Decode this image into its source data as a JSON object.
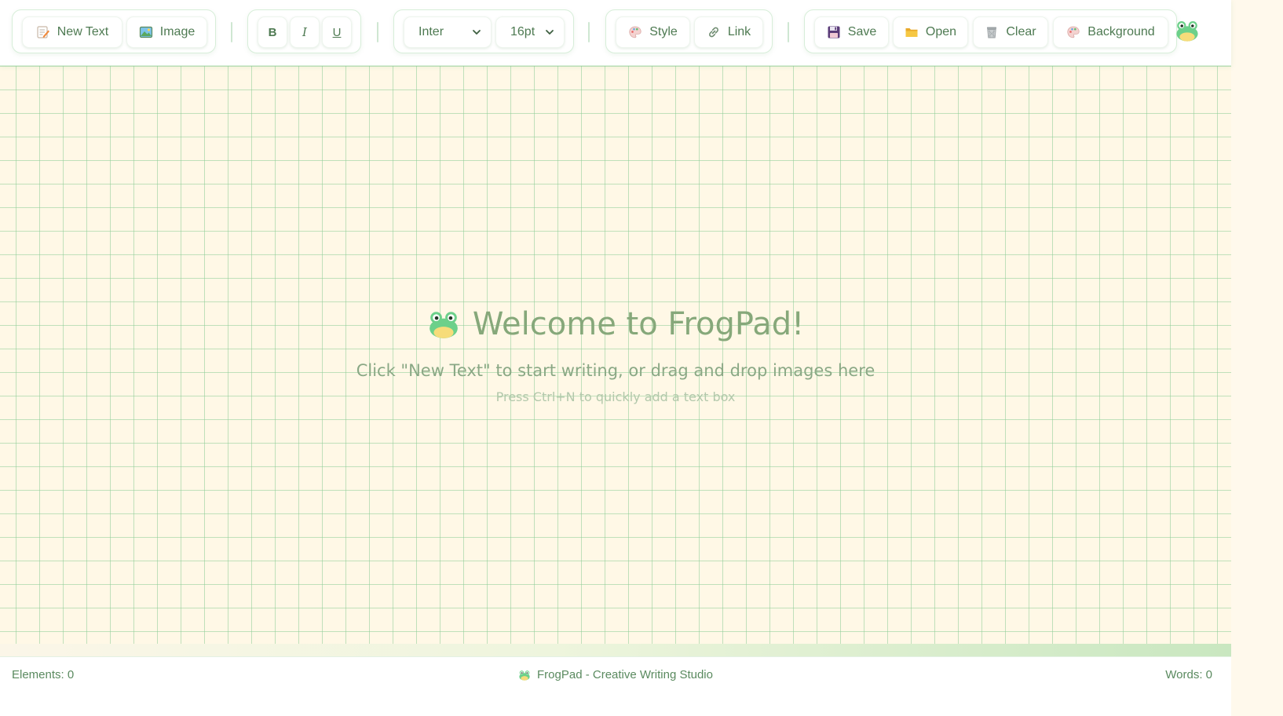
{
  "toolbar": {
    "insert": {
      "new_text": "New Text",
      "image": "Image"
    },
    "format": {
      "bold": "B",
      "italic": "I",
      "underline": "U"
    },
    "font": {
      "family": "Inter",
      "size": "16pt"
    },
    "extras": {
      "style": "Style",
      "link": "Link"
    },
    "file": {
      "save": "Save",
      "open": "Open",
      "clear": "Clear",
      "background": "Background"
    },
    "icons": {
      "new_text": "memo-icon",
      "image": "picture-icon",
      "style": "palette-icon",
      "link": "link-icon",
      "save": "floppy-disk-icon",
      "open": "folder-icon",
      "clear": "wastebasket-icon",
      "background": "palette-icon",
      "logo": "frog-icon"
    }
  },
  "canvas": {
    "title": "Welcome to FrogPad!",
    "subtitle": "Click \"New Text\" to start writing, or drag and drop images here",
    "hint": "Press Ctrl+N to quickly add a text box"
  },
  "status": {
    "elements": "Elements: 0",
    "app_name": "FrogPad - Creative Writing Studio",
    "words": "Words: 0"
  },
  "colors": {
    "accent": "#4e7a52",
    "canvas_bg": "#fff8e6",
    "grid": "#a9dbb0",
    "welcome_text": "#86a87a"
  }
}
